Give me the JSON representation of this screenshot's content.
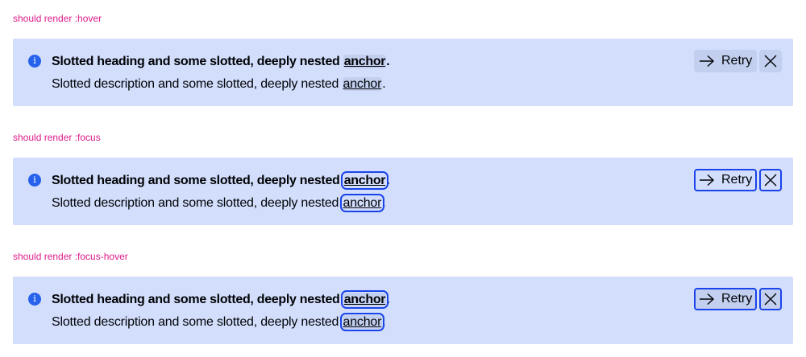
{
  "sections": [
    {
      "label": "should render :hover",
      "heading": "Slotted heading and some slotted, deeply nested",
      "heading_link": "anchor",
      "description": "Slotted description and some slotted, deeply nested",
      "description_link": "anchor",
      "retry_label": "Retry"
    },
    {
      "label": "should render :focus",
      "heading": "Slotted heading and some slotted, deeply nested",
      "heading_link": "anchor",
      "description": "Slotted description and some slotted, deeply nested",
      "description_link": "anchor",
      "retry_label": "Retry"
    },
    {
      "label": "should render :focus-hover",
      "heading": "Slotted heading and some slotted, deeply nested",
      "heading_link": "anchor",
      "description": "Slotted description and some slotted, deeply nested",
      "description_link": "anchor",
      "retry_label": "Retry"
    }
  ],
  "punctuation": ".",
  "colors": {
    "label": "#de1a8b",
    "banner_background": "#d2defc",
    "info_icon": "#2762ec",
    "focus_outline": "#1a44ea",
    "hover_background": "#c2cfee"
  },
  "icons": {
    "info": "info-icon",
    "retry": "arrow-right-icon",
    "close": "close-icon"
  }
}
